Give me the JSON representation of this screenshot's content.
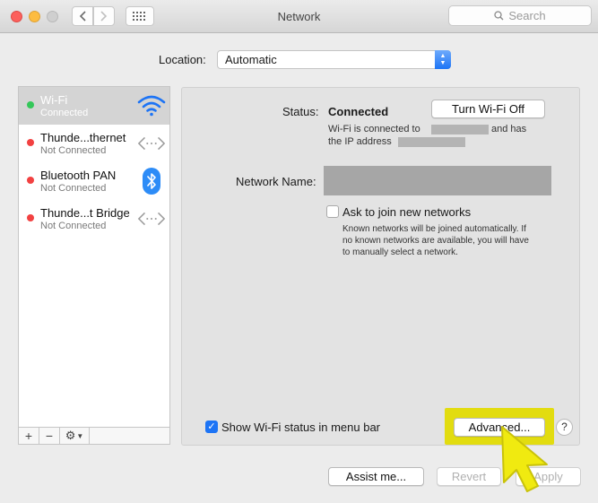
{
  "window": {
    "title": "Network"
  },
  "search": {
    "placeholder": "Search"
  },
  "location": {
    "label": "Location:",
    "value": "Automatic"
  },
  "services": [
    {
      "name": "Wi-Fi",
      "status": "Connected",
      "dot_color": "#34c759",
      "icon": "wifi-icon"
    },
    {
      "name": "Thunde...thernet",
      "status": "Not Connected",
      "dot_color": "#f24141",
      "icon": "ethernet-arrows-icon"
    },
    {
      "name": "Bluetooth PAN",
      "status": "Not Connected",
      "dot_color": "#f24141",
      "icon": "bluetooth-icon"
    },
    {
      "name": "Thunde...t Bridge",
      "status": "Not Connected",
      "dot_color": "#f24141",
      "icon": "ethernet-arrows-icon"
    }
  ],
  "sidebar_tools": {
    "add": "+",
    "remove": "−",
    "gear": "⚙︎"
  },
  "detail": {
    "status_label": "Status:",
    "status_value": "Connected",
    "toggle_button": "Turn Wi-Fi Off",
    "status_desc_1": "Wi-Fi is connected to",
    "status_desc_2": "and has",
    "status_desc_3": "the IP address",
    "network_name_label": "Network Name:",
    "ask_join_label": "Ask to join new networks",
    "ask_join_desc_1": "Known networks will be joined automatically. If",
    "ask_join_desc_2": "no known networks are available, you will have",
    "ask_join_desc_3": "to manually select a network.",
    "show_status_label": "Show Wi-Fi status in menu bar",
    "advanced_button": "Advanced...",
    "help_button": "?"
  },
  "footer": {
    "assist": "Assist me...",
    "revert": "Revert",
    "apply": "Apply"
  },
  "colors": {
    "accent": "#1d74f5",
    "highlight": "#e2dc10",
    "cursor_yellow": "#f0ea10"
  }
}
